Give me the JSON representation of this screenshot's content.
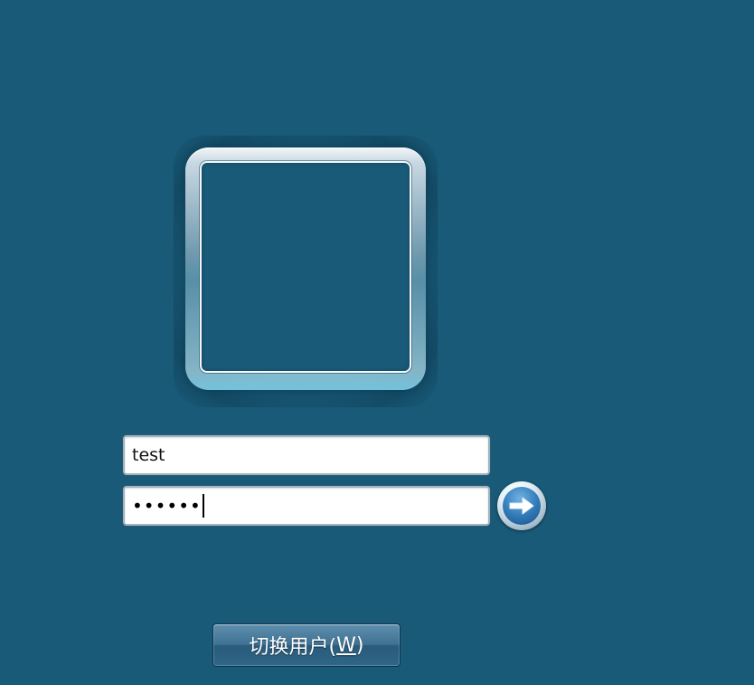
{
  "user_tile": {
    "picture": "blank-user-picture"
  },
  "login_form": {
    "username_value": "test",
    "password_value": "••••••",
    "submit_icon": "right-arrow-icon"
  },
  "switch_user": {
    "label_prefix": "切换用户(",
    "label_mnemonic": "W",
    "label_suffix": ")"
  },
  "colors": {
    "background": "#195a78",
    "arrow_button": "#2f78b6"
  }
}
